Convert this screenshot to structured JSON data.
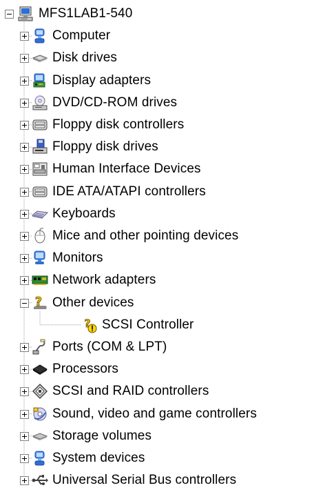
{
  "root": {
    "label": "MFS1LAB1-540",
    "icon": "computer-monitor-icon",
    "expanded": true
  },
  "categories": [
    {
      "label": "Computer",
      "icon": "computer-icon",
      "expanded": false
    },
    {
      "label": "Disk drives",
      "icon": "disk-drive-icon",
      "expanded": false
    },
    {
      "label": "Display adapters",
      "icon": "display-adapter-icon",
      "expanded": false
    },
    {
      "label": "DVD/CD-ROM drives",
      "icon": "cdrom-icon",
      "expanded": false
    },
    {
      "label": "Floppy disk controllers",
      "icon": "controller-icon",
      "expanded": false
    },
    {
      "label": "Floppy disk drives",
      "icon": "floppy-drive-icon",
      "expanded": false
    },
    {
      "label": "Human Interface Devices",
      "icon": "hid-icon",
      "expanded": false
    },
    {
      "label": "IDE ATA/ATAPI controllers",
      "icon": "controller-icon",
      "expanded": false
    },
    {
      "label": "Keyboards",
      "icon": "keyboard-icon",
      "expanded": false
    },
    {
      "label": "Mice and other pointing devices",
      "icon": "mouse-icon",
      "expanded": false
    },
    {
      "label": "Monitors",
      "icon": "monitor-icon",
      "expanded": false
    },
    {
      "label": "Network adapters",
      "icon": "network-adapter-icon",
      "expanded": false
    },
    {
      "label": "Other devices",
      "icon": "unknown-device-icon",
      "expanded": true,
      "children": [
        {
          "label": "SCSI Controller",
          "icon": "warning-device-icon"
        }
      ]
    },
    {
      "label": "Ports (COM & LPT)",
      "icon": "port-icon",
      "expanded": false
    },
    {
      "label": "Processors",
      "icon": "processor-icon",
      "expanded": false
    },
    {
      "label": "SCSI and RAID controllers",
      "icon": "scsi-icon",
      "expanded": false
    },
    {
      "label": "Sound, video and game controllers",
      "icon": "sound-icon",
      "expanded": false
    },
    {
      "label": "Storage volumes",
      "icon": "storage-volume-icon",
      "expanded": false
    },
    {
      "label": "System devices",
      "icon": "system-device-icon",
      "expanded": false
    },
    {
      "label": "Universal Serial Bus controllers",
      "icon": "usb-icon",
      "expanded": false
    }
  ],
  "colors": {
    "tree_line": "#a0a0a0",
    "expander_border": "#7f7f7f",
    "warning_yellow": "#ffd800"
  }
}
